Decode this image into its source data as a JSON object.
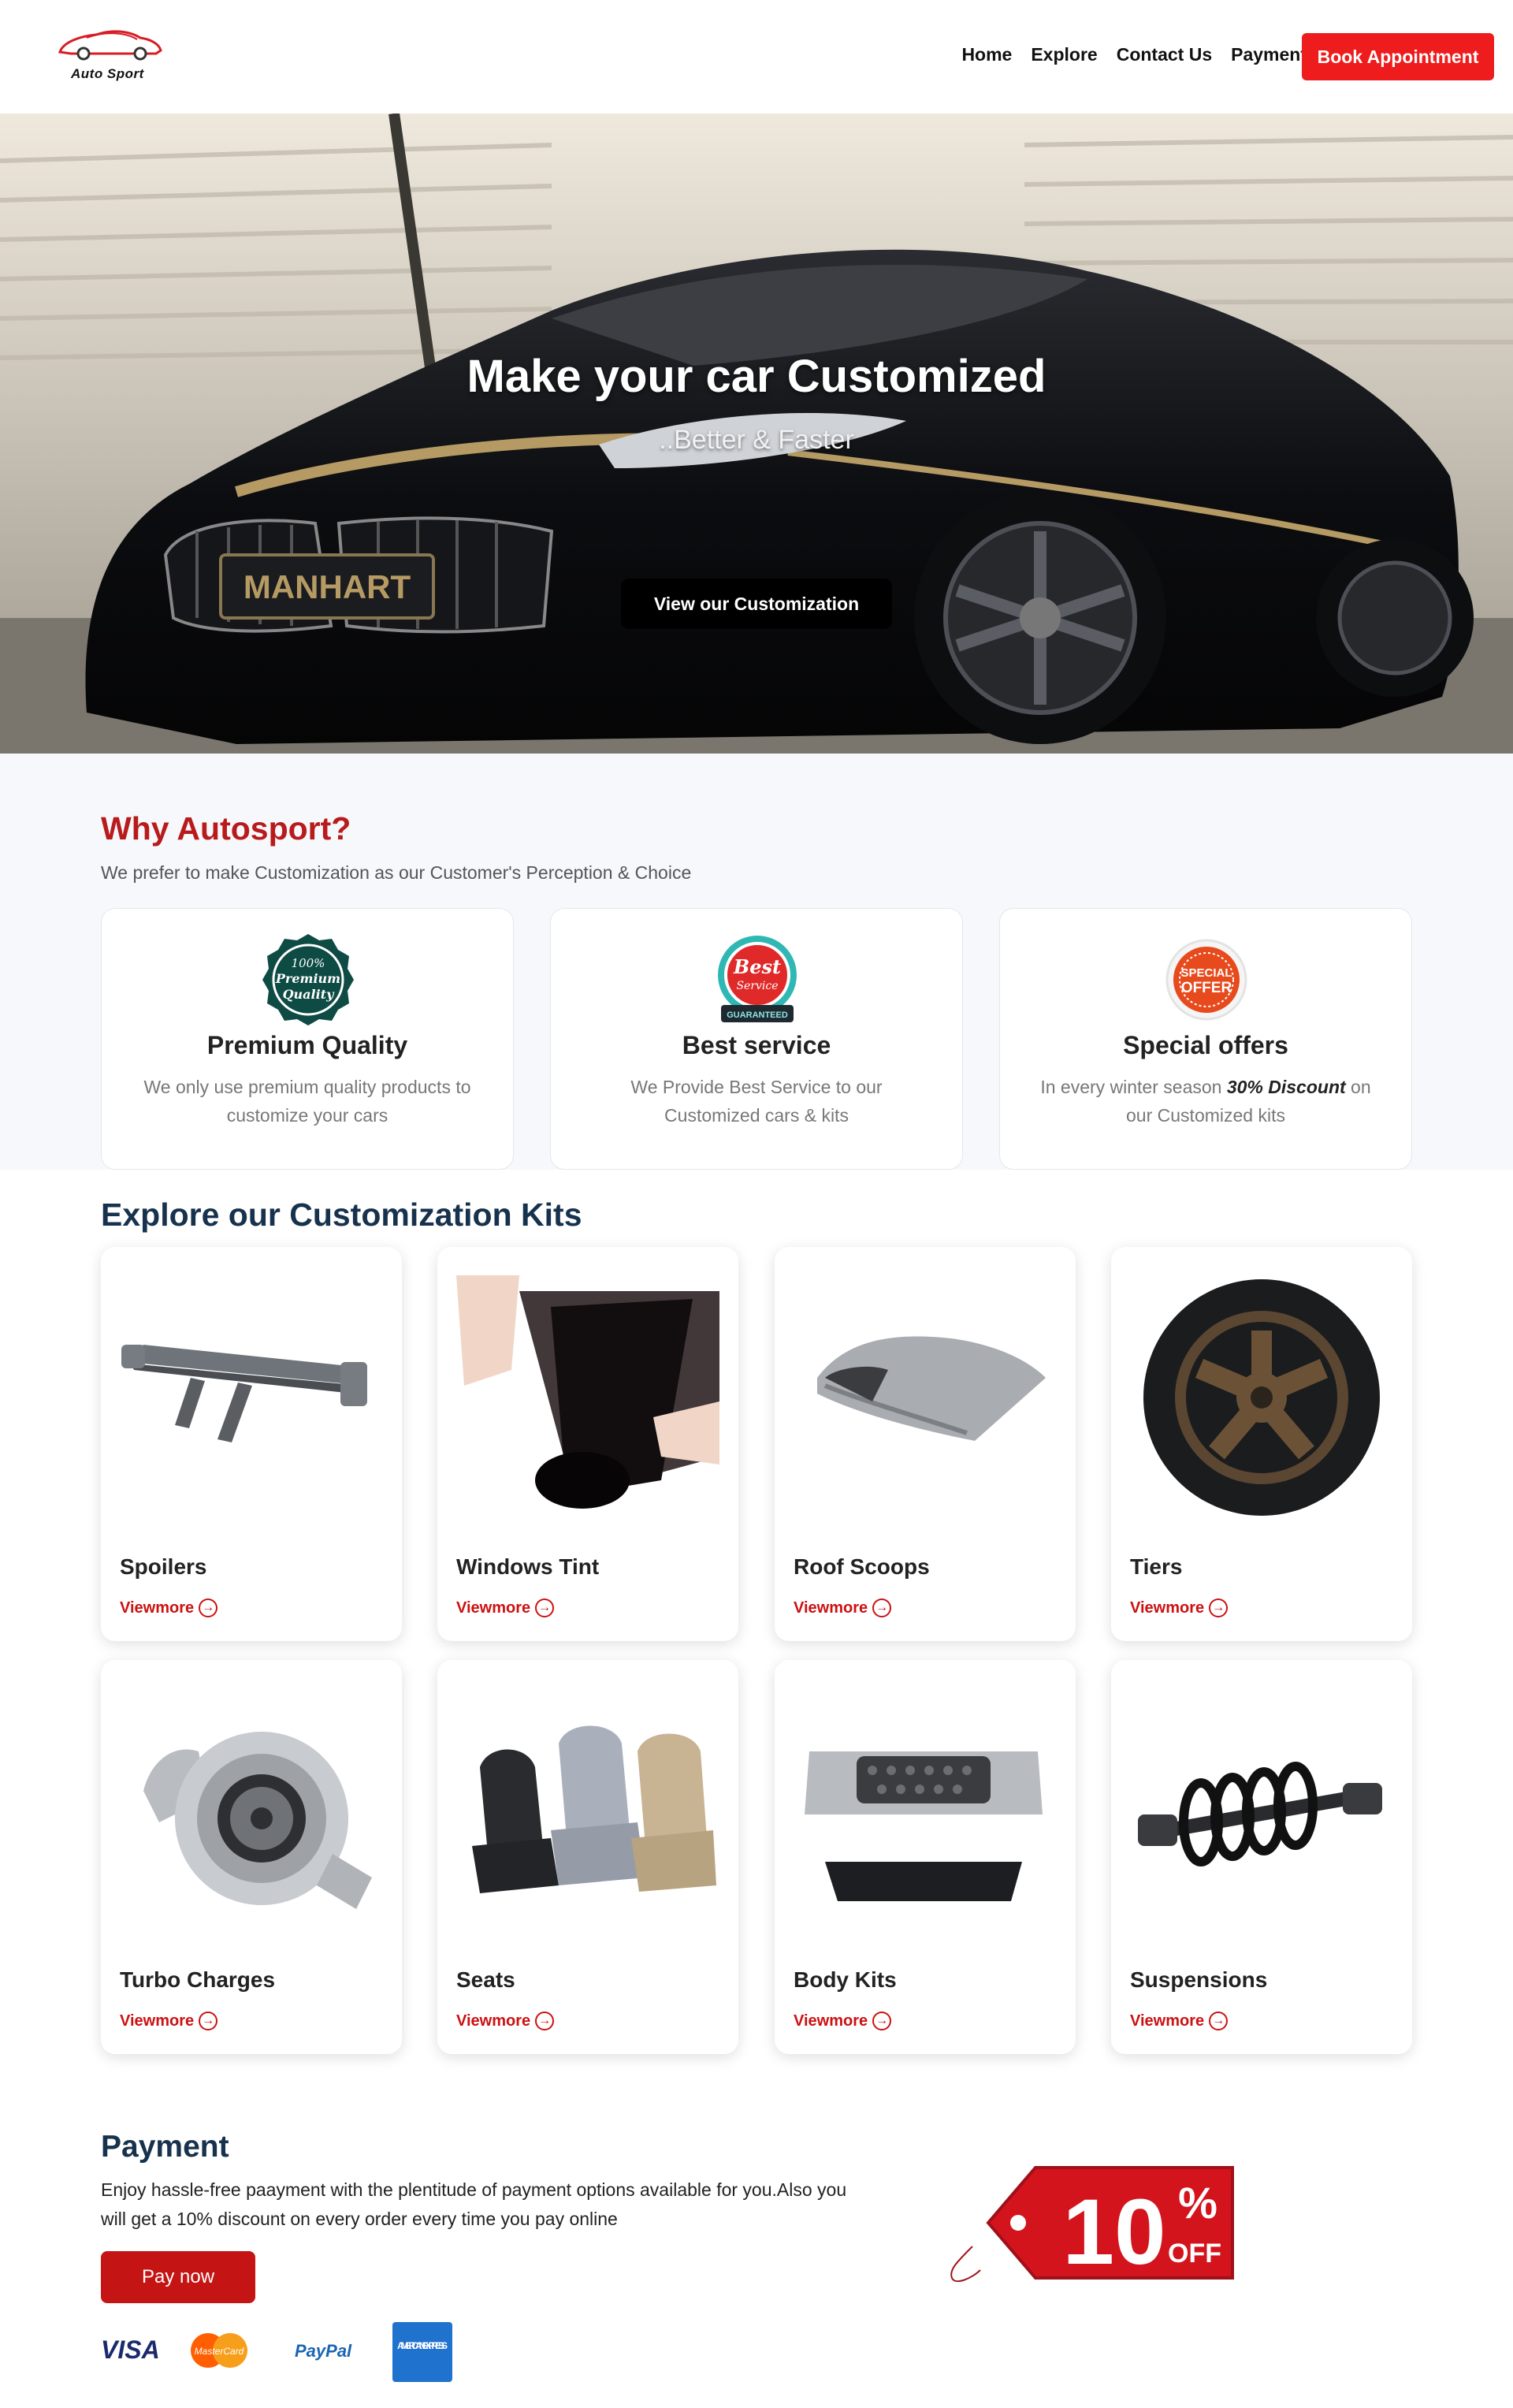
{
  "brand": {
    "logo_text": "Auto Sport",
    "accent": "#ee1c1c"
  },
  "nav": {
    "links": [
      "Home",
      "Explore",
      "Contact Us",
      "Payment"
    ],
    "book_label": "Book Appointment"
  },
  "hero": {
    "title": "Make your car Customized",
    "subtitle": "..Better & Faster",
    "button": "View our Customization"
  },
  "why": {
    "title": "Why Autosport?",
    "subtitle": "We prefer to make Customization as our Customer's Perception & Choice",
    "features": [
      {
        "title": "Premium Quality",
        "text": "We only use premium quality products to customize your cars",
        "badge_text": [
          "100%",
          "Premium",
          "Quality"
        ],
        "icon": "premium-quality-badge"
      },
      {
        "title": "Best service",
        "text": "We Provide Best Service to our Customized cars & kits",
        "badge_text": [
          "Best",
          "Service",
          "GUARANTEED"
        ],
        "icon": "best-service-badge"
      },
      {
        "title": "Special offers",
        "text_before": "In every winter season ",
        "text_bold": "30% Discount",
        "text_after": " on our Customized kits",
        "badge_text": [
          "SPECIAL",
          "OFFER"
        ],
        "icon": "special-offer-badge"
      }
    ]
  },
  "explore": {
    "title": "Explore our Customization Kits",
    "more_label": "Viewmore",
    "items": [
      {
        "name": "Spoilers",
        "icon": "spoiler-image"
      },
      {
        "name": "Windows Tint",
        "icon": "window-tint-image"
      },
      {
        "name": "Roof Scoops",
        "icon": "roof-scoop-image"
      },
      {
        "name": "Tiers",
        "icon": "tire-image"
      },
      {
        "name": "Turbo Charges",
        "icon": "turbo-image"
      },
      {
        "name": "Seats",
        "icon": "seats-image"
      },
      {
        "name": "Body Kits",
        "icon": "body-kit-image"
      },
      {
        "name": "Suspensions",
        "icon": "suspension-image"
      }
    ]
  },
  "payment": {
    "title": "Payment",
    "text": "Enjoy hassle-free paayment with the plentitude of payment options available for you.Also you will get a 10% discount on every order every time you pay online",
    "button": "Pay now",
    "methods": [
      "VISA",
      "MasterCard",
      "PayPal",
      "AMERICAN EXPRESS"
    ],
    "promo": {
      "value": "10",
      "unit": "%",
      "label": "OFF"
    }
  },
  "hero_plate_text": "MANHART"
}
